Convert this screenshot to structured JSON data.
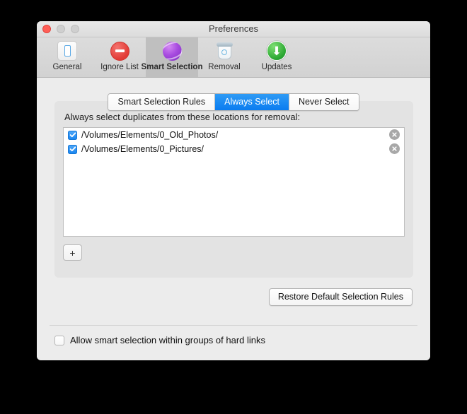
{
  "window": {
    "title": "Preferences",
    "traffic_lights": [
      "close",
      "minimize",
      "maximize"
    ]
  },
  "toolbar": {
    "items": [
      {
        "label": "General",
        "icon": "device-icon",
        "selected": false
      },
      {
        "label": "Ignore List",
        "icon": "no-entry-icon",
        "selected": false
      },
      {
        "label": "Smart Selection",
        "icon": "purple-sphere-icon",
        "selected": true
      },
      {
        "label": "Removal",
        "icon": "trash-icon",
        "selected": false
      },
      {
        "label": "Updates",
        "icon": "download-arrow-icon",
        "selected": false
      }
    ]
  },
  "tabs": [
    {
      "label": "Smart Selection Rules",
      "active": false
    },
    {
      "label": "Always Select",
      "active": true
    },
    {
      "label": "Never Select",
      "active": false
    }
  ],
  "panel": {
    "label": "Always select duplicates from these locations for removal:",
    "locations": [
      {
        "path": "/Volumes/Elements/0_Old_Photos/",
        "checked": true
      },
      {
        "path": "/Volumes/Elements/0_Pictures/",
        "checked": true
      }
    ],
    "add_button_label": "+"
  },
  "restore_button": {
    "label": "Restore Default Selection Rules"
  },
  "hardlink_option": {
    "label": "Allow smart selection within groups of hard links",
    "checked": false
  },
  "colors": {
    "accent_blue": "#0a7cf0",
    "checkbox_blue": "#1a86f0",
    "window_bg": "#ececec",
    "panel_bg": "#e3e3e3",
    "toolbar_selected": "#bfbfbf",
    "close_red": "#ff5f57",
    "update_green": "#2faa35",
    "smart_purple": "#a84ce0"
  }
}
